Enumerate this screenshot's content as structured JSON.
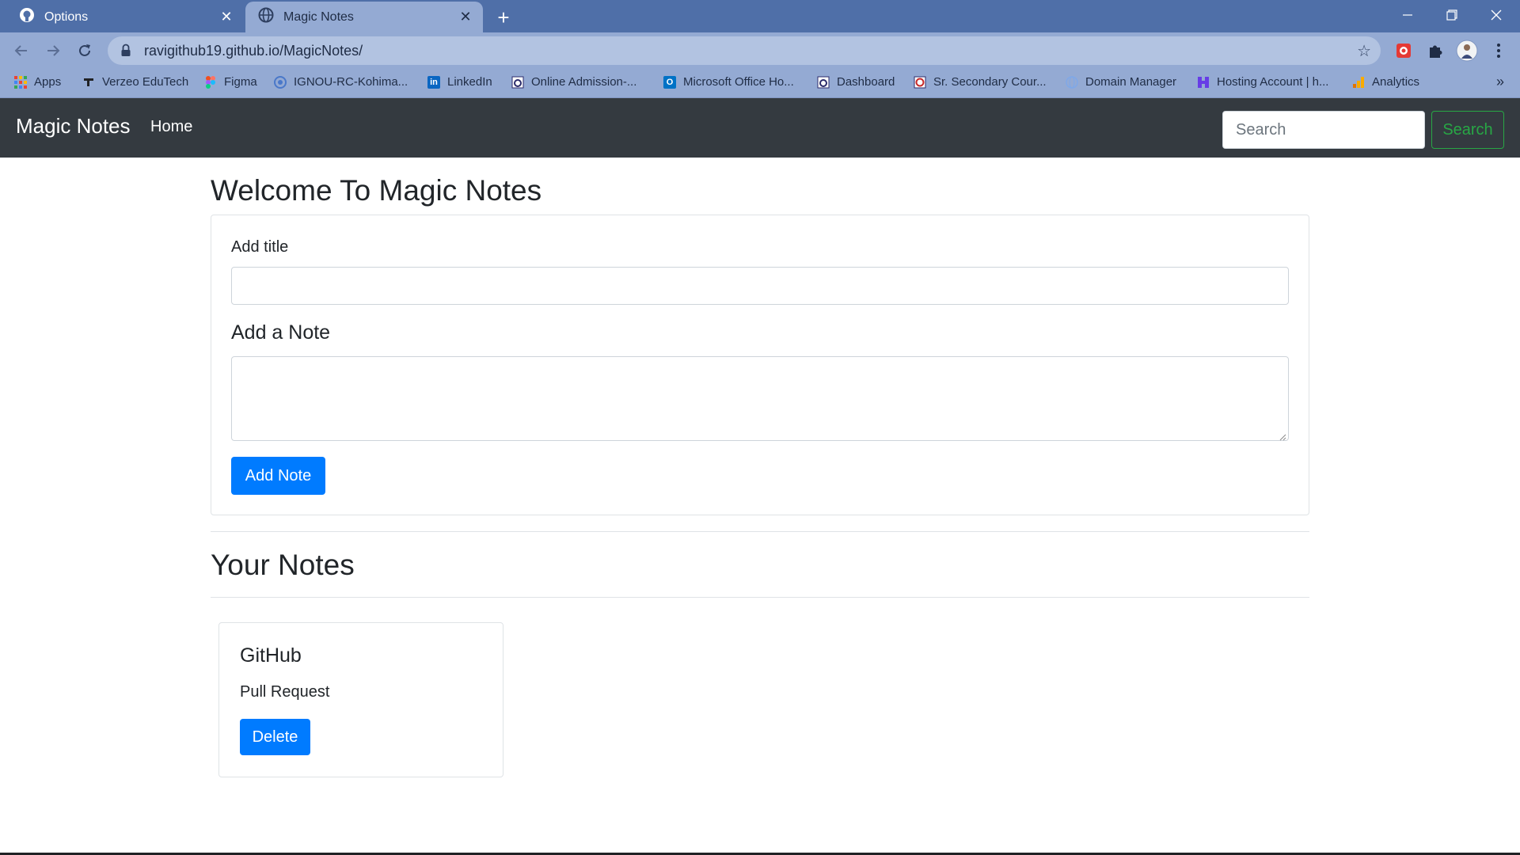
{
  "browser": {
    "tabs": [
      {
        "title": "Options",
        "icon": "github-icon"
      },
      {
        "title": "Magic Notes",
        "icon": "globe-icon",
        "active": true
      }
    ],
    "url": "ravigithub19.github.io/MagicNotes/",
    "bookmarks": [
      {
        "label": "Apps",
        "icon": "apps-grid-icon",
        "color": "#e94235"
      },
      {
        "label": "Verzeo EduTech",
        "icon": "verzeo-icon",
        "color": "#202124"
      },
      {
        "label": "Figma",
        "icon": "figma-icon",
        "color": "#f24e1e"
      },
      {
        "label": "IGNOU-RC-Kohima...",
        "icon": "ignou-icon",
        "color": "#4a78c9"
      },
      {
        "label": "LinkedIn",
        "icon": "linkedin-icon",
        "color": "#0a66c2"
      },
      {
        "label": "Online Admission-...",
        "icon": "ignou-seal-icon",
        "color": "#2b2b6b"
      },
      {
        "label": "Microsoft Office Ho...",
        "icon": "outlook-icon",
        "color": "#0072c6"
      },
      {
        "label": "Dashboard",
        "icon": "ignou-seal-icon",
        "color": "#2b2b6b"
      },
      {
        "label": "Sr. Secondary Cour...",
        "icon": "nios-icon",
        "color": "#2b2b6b"
      },
      {
        "label": "Domain Manager",
        "icon": "globe-icon",
        "color": "#7fa8e8"
      },
      {
        "label": "Hosting Account | h...",
        "icon": "hostinger-icon",
        "color": "#673de6"
      },
      {
        "label": "Analytics",
        "icon": "analytics-icon",
        "color": "#f9ab00"
      }
    ],
    "bookmarks_more": "»"
  },
  "navbar": {
    "brand": "Magic Notes",
    "home": "Home",
    "search_placeholder": "Search",
    "search_button": "Search"
  },
  "form": {
    "heading": "Welcome To Magic Notes",
    "title_label": "Add title",
    "note_label": "Add a Note",
    "add_button": "Add Note"
  },
  "notes_section": {
    "heading": "Your Notes",
    "notes": [
      {
        "title": "GitHub",
        "text": "Pull Request",
        "delete_label": "Delete"
      }
    ]
  },
  "colors": {
    "navbar_bg": "#343a40",
    "primary": "#007bff",
    "success": "#28a745",
    "tabstrip": "#4f6fa8",
    "toolbar": "#94aad3"
  }
}
